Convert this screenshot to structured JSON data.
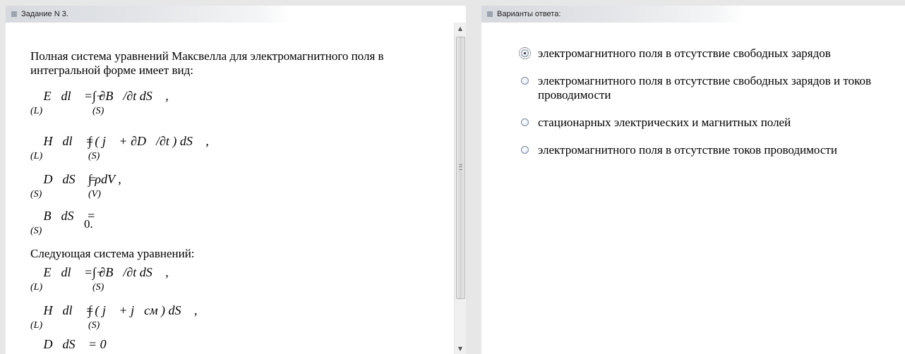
{
  "left_panel": {
    "title": "Задание N 3.",
    "question_text": "Полная система уравнений Максвелла для электромагнитного поля в интегральной форме имеет вид:",
    "equations_full": [
      {
        "lhs": "∮ E⃗dl⃗ = −",
        "rhs": "∫ ∂B⃗/∂t dS⃗ ,",
        "lower_left": "(L)",
        "lower_right": "(S)"
      },
      {
        "lhs": "∮ H⃗dl⃗ = ",
        "rhs": "∫ ( j⃗ + ∂D⃗/∂t ) dS⃗ ,",
        "lower_left": "(L)",
        "lower_right": "(S)"
      },
      {
        "lhs": "∮ D⃗dS⃗ = ",
        "rhs": "∫ ρdV ,",
        "lower_left": "(S)",
        "lower_right": "(V)"
      },
      {
        "lhs": "∮ B⃗dS⃗ = ",
        "rhs": "0.",
        "lower_left": "(S)",
        "lower_right": ""
      }
    ],
    "following_text": "Следующая система уравнений:",
    "equations_following": [
      {
        "lhs": "∮ E⃗dl⃗ = −",
        "rhs": "∫ ∂B⃗/∂t dS⃗ ,",
        "lower_left": "(L)",
        "lower_right": "(S)"
      },
      {
        "lhs": "∮ H⃗dl⃗ = ",
        "rhs": "∫ ( j⃗ + j⃗см ) dS⃗ ,",
        "lower_left": "(L)",
        "lower_right": "(S)"
      },
      {
        "lhs": "∮ D⃗dS⃗ = 0",
        "rhs": "",
        "lower_left": "",
        "lower_right": ""
      }
    ]
  },
  "right_panel": {
    "title": "Варианты ответа:",
    "answers": [
      {
        "label": "электромагнитного поля в отсутствие свободных зарядов",
        "selected": true
      },
      {
        "label": "электромагнитного поля в отсутствие свободных зарядов и токов проводимости",
        "selected": false
      },
      {
        "label": "стационарных электрических и магнитных полей",
        "selected": false
      },
      {
        "label": "электромагнитного поля в отсутствие токов проводимости",
        "selected": false
      }
    ]
  },
  "icons": {
    "panel_header": "square-bullet-icon",
    "scroll_up": "arrow-up-icon",
    "scroll_down": "arrow-down-icon"
  },
  "colors": {
    "background": "#e7e7e7",
    "panel": "#ffffff",
    "header_bullet": "#9aa3b2"
  }
}
